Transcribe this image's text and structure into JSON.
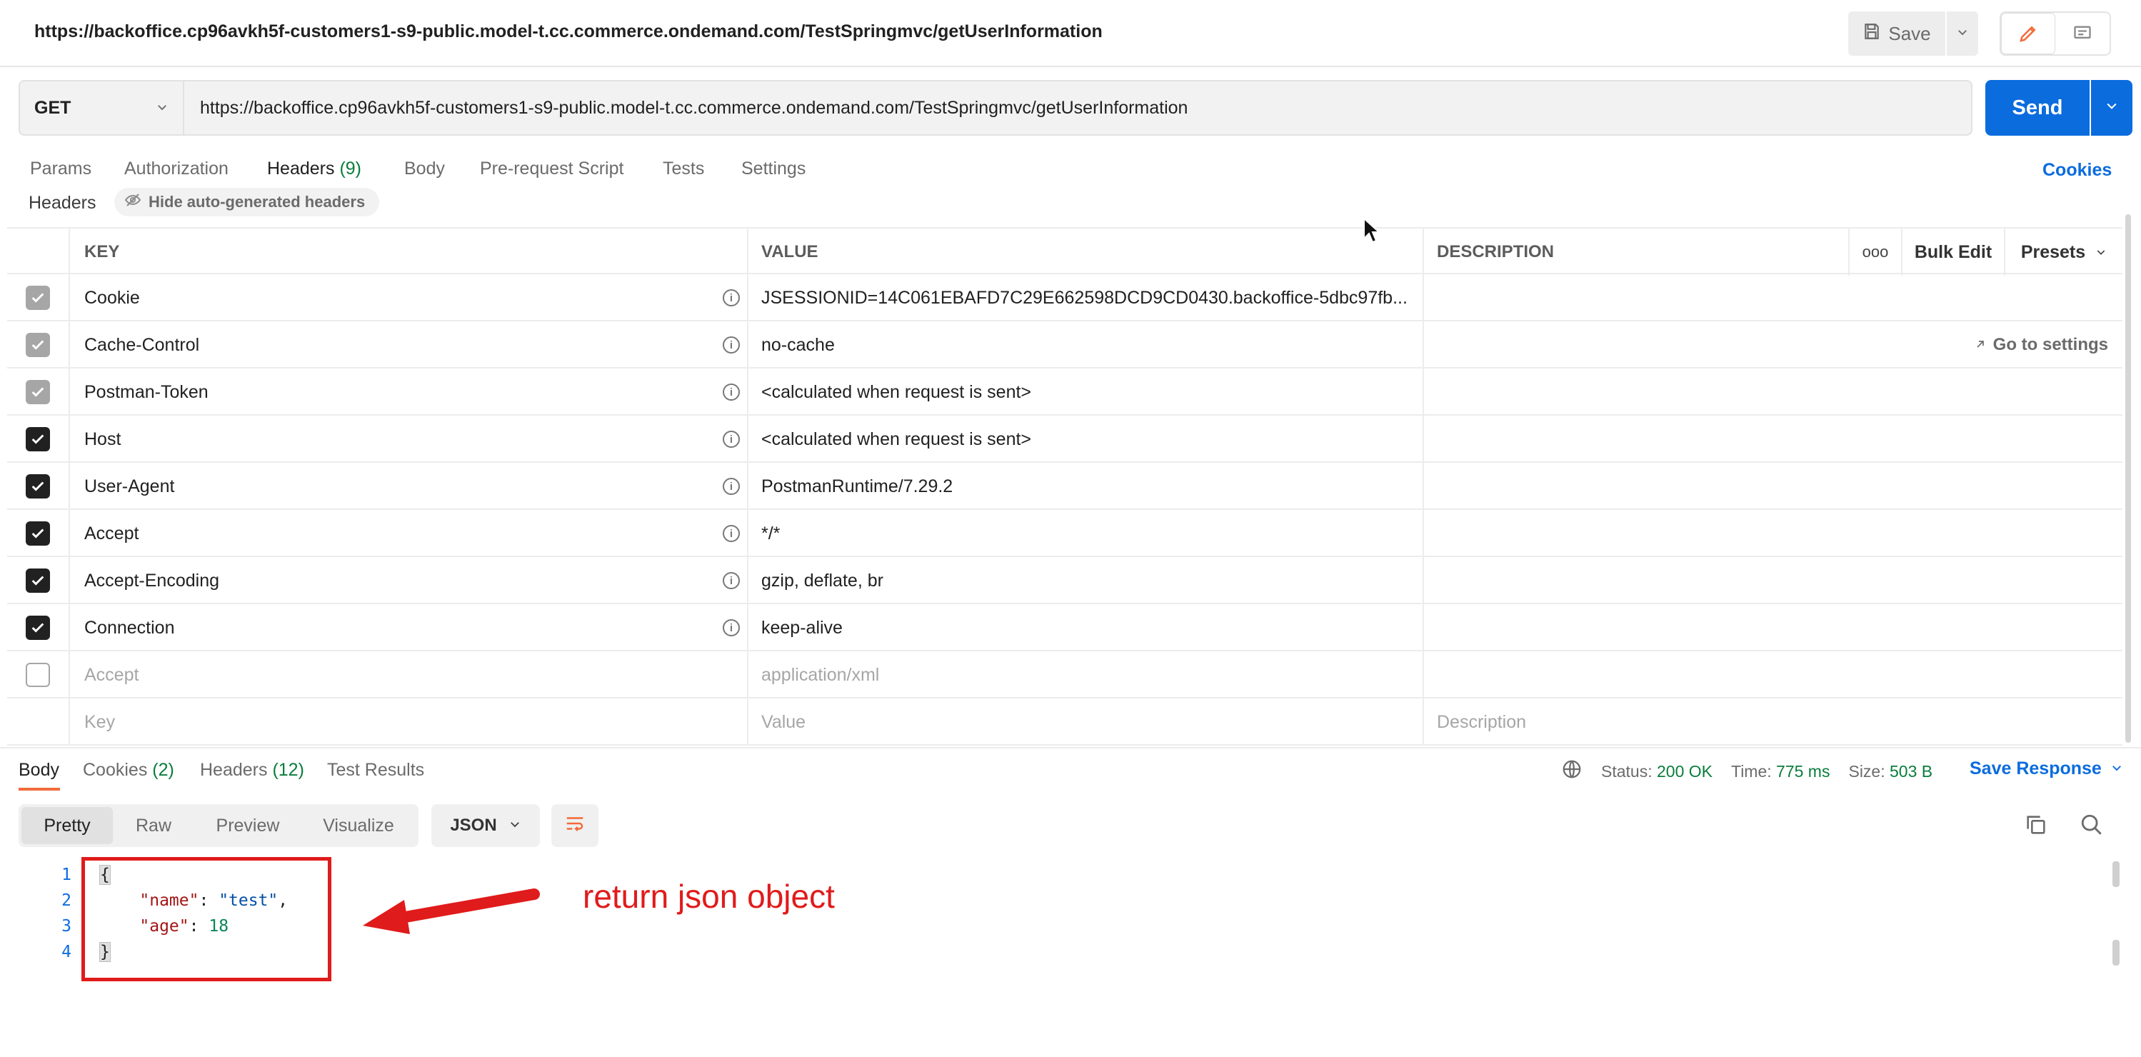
{
  "window": {
    "title_url": "https://backoffice.cp96avkh5f-customers1-s9-public.model-t.cc.commerce.ondemand.com/TestSpringmvc/getUserInformation",
    "save_label": "Save"
  },
  "request": {
    "method": "GET",
    "url": "https://backoffice.cp96avkh5f-customers1-s9-public.model-t.cc.commerce.ondemand.com/TestSpringmvc/getUserInformation",
    "send_label": "Send"
  },
  "request_tabs": {
    "params": "Params",
    "authorization": "Authorization",
    "headers": "Headers",
    "headers_count": "(9)",
    "body": "Body",
    "prerequest": "Pre-request Script",
    "tests": "Tests",
    "settings": "Settings",
    "cookies": "Cookies"
  },
  "headers_section": {
    "label": "Headers",
    "hide_auto": "Hide auto-generated headers",
    "columns": {
      "key": "KEY",
      "value": "VALUE",
      "description": "DESCRIPTION"
    },
    "more": "ooo",
    "bulk_edit": "Bulk Edit",
    "presets": "Presets",
    "go_to_settings": "Go to settings",
    "rows": [
      {
        "key": "Cookie",
        "value": "JSESSIONID=14C061EBAFD7C29E662598DCD9CD0430.backoffice-5dbc97fb...",
        "state": "dim"
      },
      {
        "key": "Cache-Control",
        "value": "no-cache",
        "state": "dim"
      },
      {
        "key": "Postman-Token",
        "value": "<calculated when request is sent>",
        "state": "dim"
      },
      {
        "key": "Host",
        "value": "<calculated when request is sent>",
        "state": "on"
      },
      {
        "key": "User-Agent",
        "value": "PostmanRuntime/7.29.2",
        "state": "on"
      },
      {
        "key": "Accept",
        "value": "*/*",
        "state": "on"
      },
      {
        "key": "Accept-Encoding",
        "value": "gzip, deflate, br",
        "state": "on"
      },
      {
        "key": "Connection",
        "value": "keep-alive",
        "state": "on"
      }
    ],
    "disabled_row": {
      "key": "Accept",
      "value": "application/xml",
      "state": "off"
    },
    "placeholders": {
      "key": "Key",
      "value": "Value",
      "description": "Description"
    }
  },
  "response": {
    "tabs": {
      "body": "Body",
      "cookies": "Cookies",
      "cookies_count": "(2)",
      "headers": "Headers",
      "headers_count": "(12)",
      "test_results": "Test Results"
    },
    "status_label": "Status:",
    "status_value": "200 OK",
    "time_label": "Time:",
    "time_value": "775 ms",
    "size_label": "Size:",
    "size_value": "503 B",
    "save_response": "Save Response",
    "views": {
      "pretty": "Pretty",
      "raw": "Raw",
      "preview": "Preview",
      "visualize": "Visualize"
    },
    "format": "JSON",
    "line_numbers": [
      "1",
      "2",
      "3",
      "4"
    ],
    "json": {
      "open": "{",
      "name_key": "\"name\"",
      "name_val": "\"test\"",
      "age_key": "\"age\"",
      "age_val": "18",
      "close": "}"
    }
  },
  "annotation": {
    "text": "return json object",
    "color": "#e01b1b"
  },
  "colors": {
    "accent_blue": "#0b6cde",
    "tab_underline": "#f26b3a",
    "status_green": "#0a7d3c"
  }
}
